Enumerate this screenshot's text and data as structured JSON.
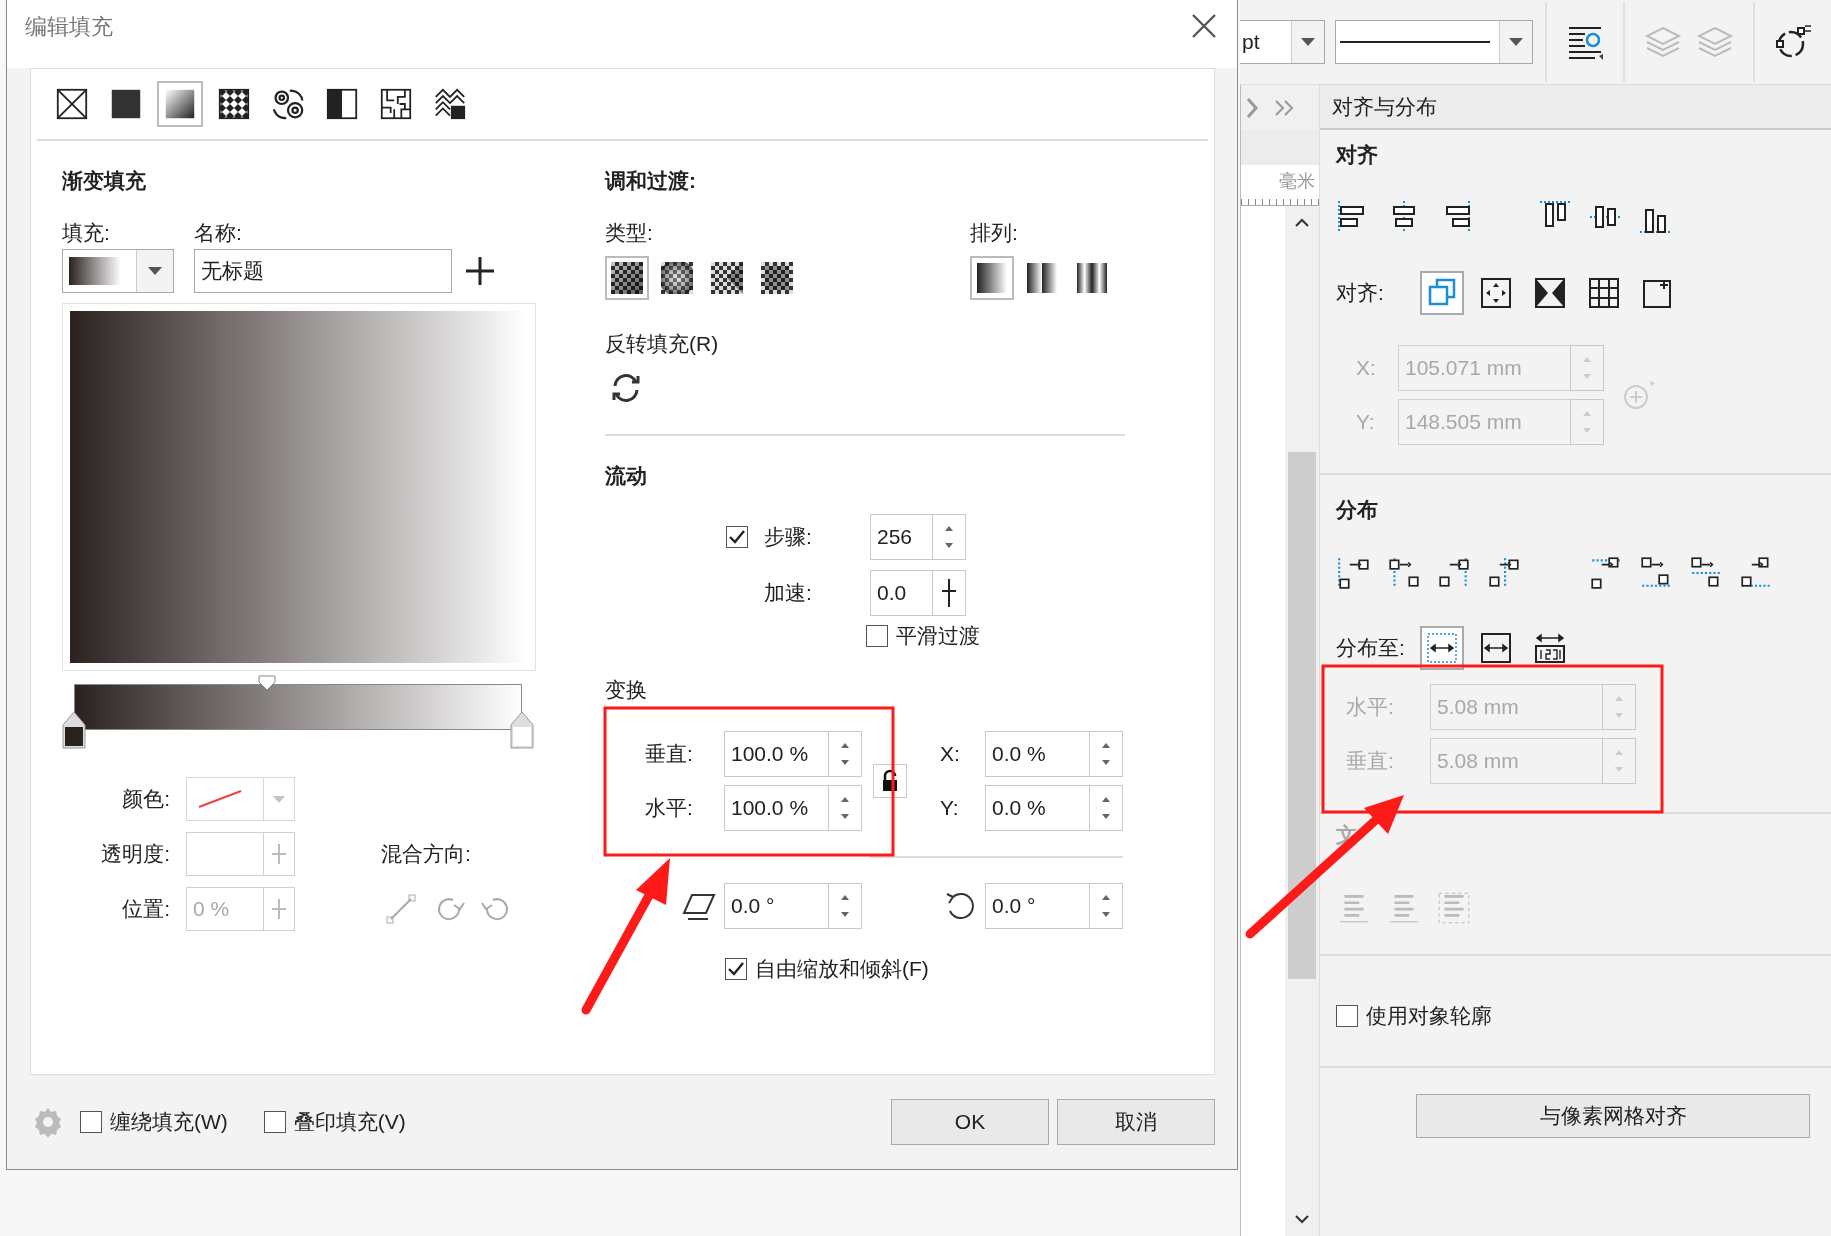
{
  "dialog": {
    "title": "编辑填充",
    "fill_types": [
      {
        "kind": "none",
        "selected": false
      },
      {
        "kind": "uniform",
        "selected": false
      },
      {
        "kind": "gradient",
        "selected": true
      },
      {
        "kind": "vector",
        "selected": false
      },
      {
        "kind": "bitmap",
        "selected": false
      },
      {
        "kind": "two_color",
        "selected": false
      },
      {
        "kind": "pattern",
        "selected": false
      },
      {
        "kind": "postscript",
        "selected": false
      }
    ],
    "gradient": {
      "heading": "渐变填充",
      "fill_label": "填充:",
      "name_label": "名称:",
      "name_value": "无标题",
      "stops": [
        {
          "color": "#2b2220"
        },
        {
          "color": "#ffffff"
        }
      ],
      "midpoint": {
        "level": 0.43
      },
      "stop_props": {
        "disabled": true,
        "color_label": "颜色:",
        "transparency_label": "透明度:",
        "position_label": "位置:",
        "position_value": "0 %"
      },
      "blend_direction_label": "混合方向:"
    },
    "blend": {
      "heading": "调和过渡:",
      "type_label": "类型:",
      "types": [
        {
          "kind": "linear",
          "selected": true
        },
        {
          "kind": "elliptical",
          "selected": false
        },
        {
          "kind": "conical",
          "selected": false
        },
        {
          "kind": "rectangular",
          "selected": false
        }
      ],
      "arrange_label": "排列:",
      "arrangements": [
        {
          "kind": "default",
          "selected": true
        },
        {
          "kind": "repeat",
          "selected": false
        },
        {
          "kind": "mirror",
          "selected": false
        }
      ],
      "reverse_label": "反转填充(R)"
    },
    "flow": {
      "heading": "流动",
      "steps": {
        "checked": true,
        "label": "步骤:",
        "value": "256"
      },
      "acceleration": {
        "label": "加速:",
        "value": "0.0"
      },
      "smooth": {
        "checked": false,
        "label": "平滑过渡"
      }
    },
    "transform": {
      "heading": "变换",
      "vertical": {
        "label": "垂直:",
        "value": "100.0 %"
      },
      "horizontal": {
        "label": "水平:",
        "value": "100.0 %"
      },
      "x": {
        "label": "X:",
        "value": "0.0 %"
      },
      "y": {
        "label": "Y:",
        "value": "0.0 %"
      },
      "skew": "0.0 °",
      "rotation": "0.0 °",
      "free_scale": {
        "checked": true,
        "label": "自由缩放和倾斜(F)"
      }
    },
    "footer": {
      "wrap": {
        "checked": false,
        "label": "缠绕填充(W)"
      },
      "overprint": {
        "checked": false,
        "label": "叠印填充(V)"
      },
      "buttons": [
        "OK",
        "取消"
      ]
    }
  },
  "toolbar": {
    "size_unit": "pt"
  },
  "ruler": {
    "unit": "毫米"
  },
  "docker": {
    "title": "对齐与分布",
    "align": {
      "heading": "对齐",
      "align_to_label": "对齐:",
      "anchors": [
        {
          "kind": "active",
          "selected": true
        },
        {
          "kind": "edge",
          "selected": false
        },
        {
          "kind": "center",
          "selected": false
        },
        {
          "kind": "grid",
          "selected": false
        },
        {
          "kind": "point",
          "selected": false
        }
      ],
      "disabled": true,
      "x": {
        "label": "X:",
        "value": "105.071 mm"
      },
      "y": {
        "label": "Y:",
        "value": "148.505 mm"
      }
    },
    "distribute": {
      "heading": "分布",
      "to_label": "分布至:",
      "targets": [
        {
          "kind": "selection",
          "selected": true
        },
        {
          "kind": "page",
          "selected": false
        },
        {
          "kind": "spacing",
          "selected": false
        }
      ],
      "disabled": true,
      "horizontal": {
        "label": "水平:",
        "value": "5.08 mm"
      },
      "vertical": {
        "label": "垂直:",
        "value": "5.08 mm"
      }
    },
    "text": {
      "heading": "文",
      "disabled": true
    },
    "use_outline": {
      "checked": false,
      "label": "使用对象轮廓"
    },
    "pixel_button": "与像素网格对齐"
  }
}
